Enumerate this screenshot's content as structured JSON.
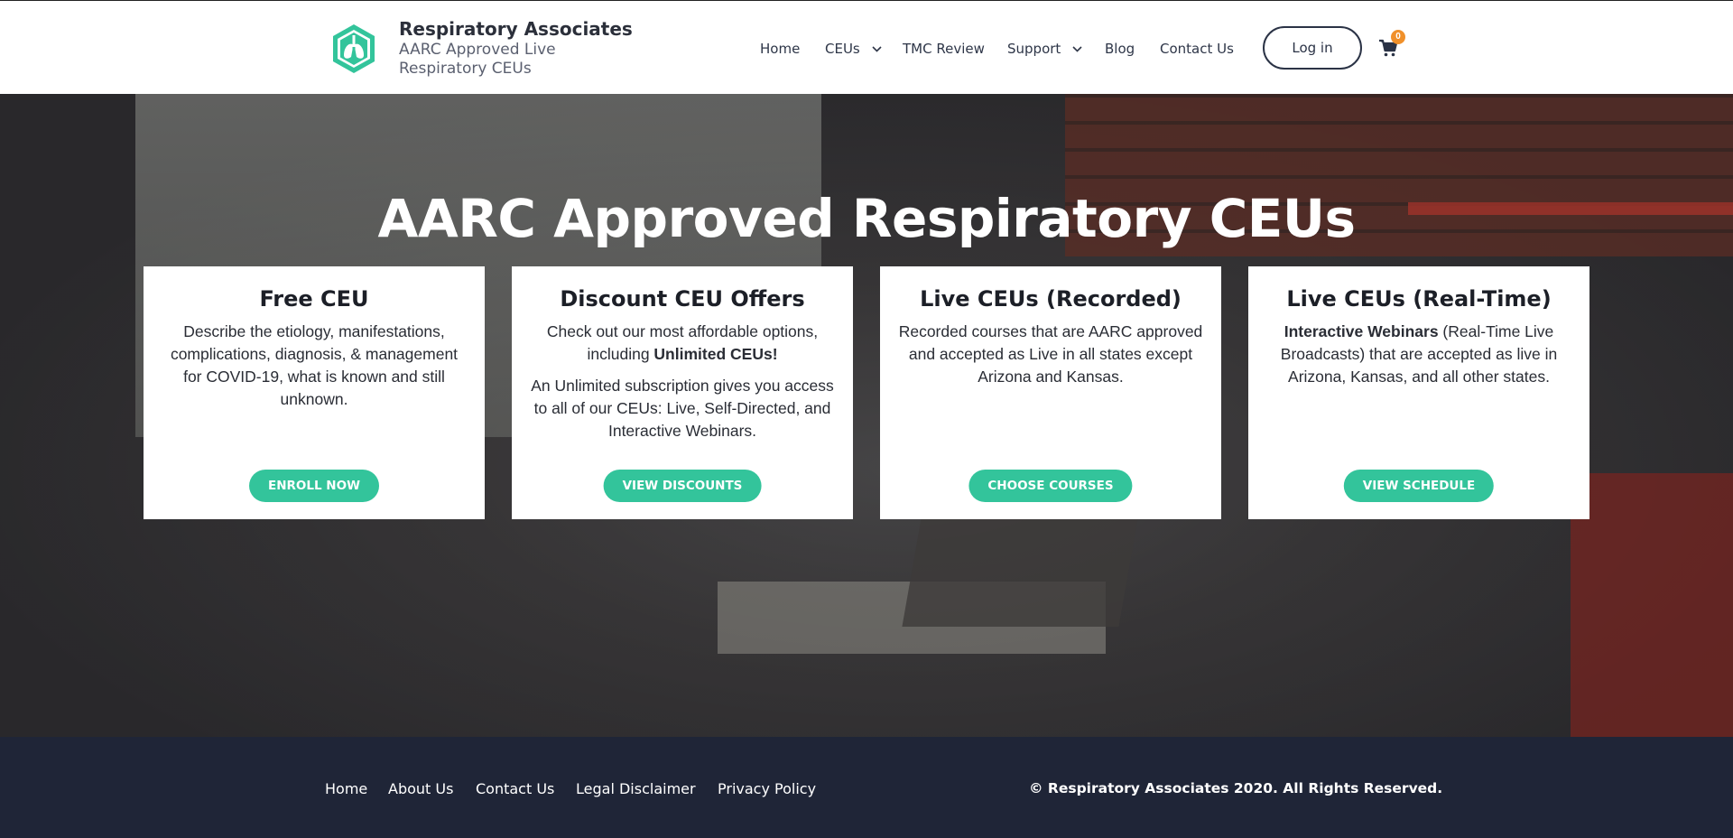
{
  "brand": {
    "title": "Respiratory Associates",
    "subtitle": "AARC Approved Live Respiratory CEUs",
    "accent": "#33c49b"
  },
  "nav": {
    "items": [
      "Home",
      "CEUs",
      "TMC Review",
      "Support",
      "Blog",
      "Contact Us"
    ],
    "login_label": "Log in",
    "cart_count": "0"
  },
  "hero": {
    "title": "AARC Approved Respiratory CEUs"
  },
  "cards": [
    {
      "title": "Free CEU",
      "text": "Describe the etiology, manifestations, complications, diagnosis, & management for COVID-19, what is known and still unknown.",
      "button": "ENROLL NOW"
    },
    {
      "title": "Discount CEU Offers",
      "text_pre": "Check out our most affordable options, including ",
      "text_bold": "Unlimited CEUs!",
      "text2": "An Unlimited subscription gives you access to all of our CEUs: Live, Self-Directed, and Interactive Webinars.",
      "button": "VIEW DISCOUNTS"
    },
    {
      "title": "Live CEUs (Recorded)",
      "text": "Recorded courses that are AARC approved and accepted as Live in all states except Arizona and Kansas.",
      "button": "CHOOSE COURSES"
    },
    {
      "title": "Live CEUs (Real-Time)",
      "text_bold": "Interactive Webinars",
      "text_post": " (Real-Time Live Broadcasts) that are accepted as live in Arizona, Kansas, and all other states.",
      "button": "VIEW SCHEDULE"
    }
  ],
  "footer": {
    "links": [
      "Home",
      "About Us",
      "Contact Us",
      "Legal Disclaimer",
      "Privacy Policy"
    ],
    "copyright": "© Respiratory Associates 2020. All Rights Reserved."
  }
}
